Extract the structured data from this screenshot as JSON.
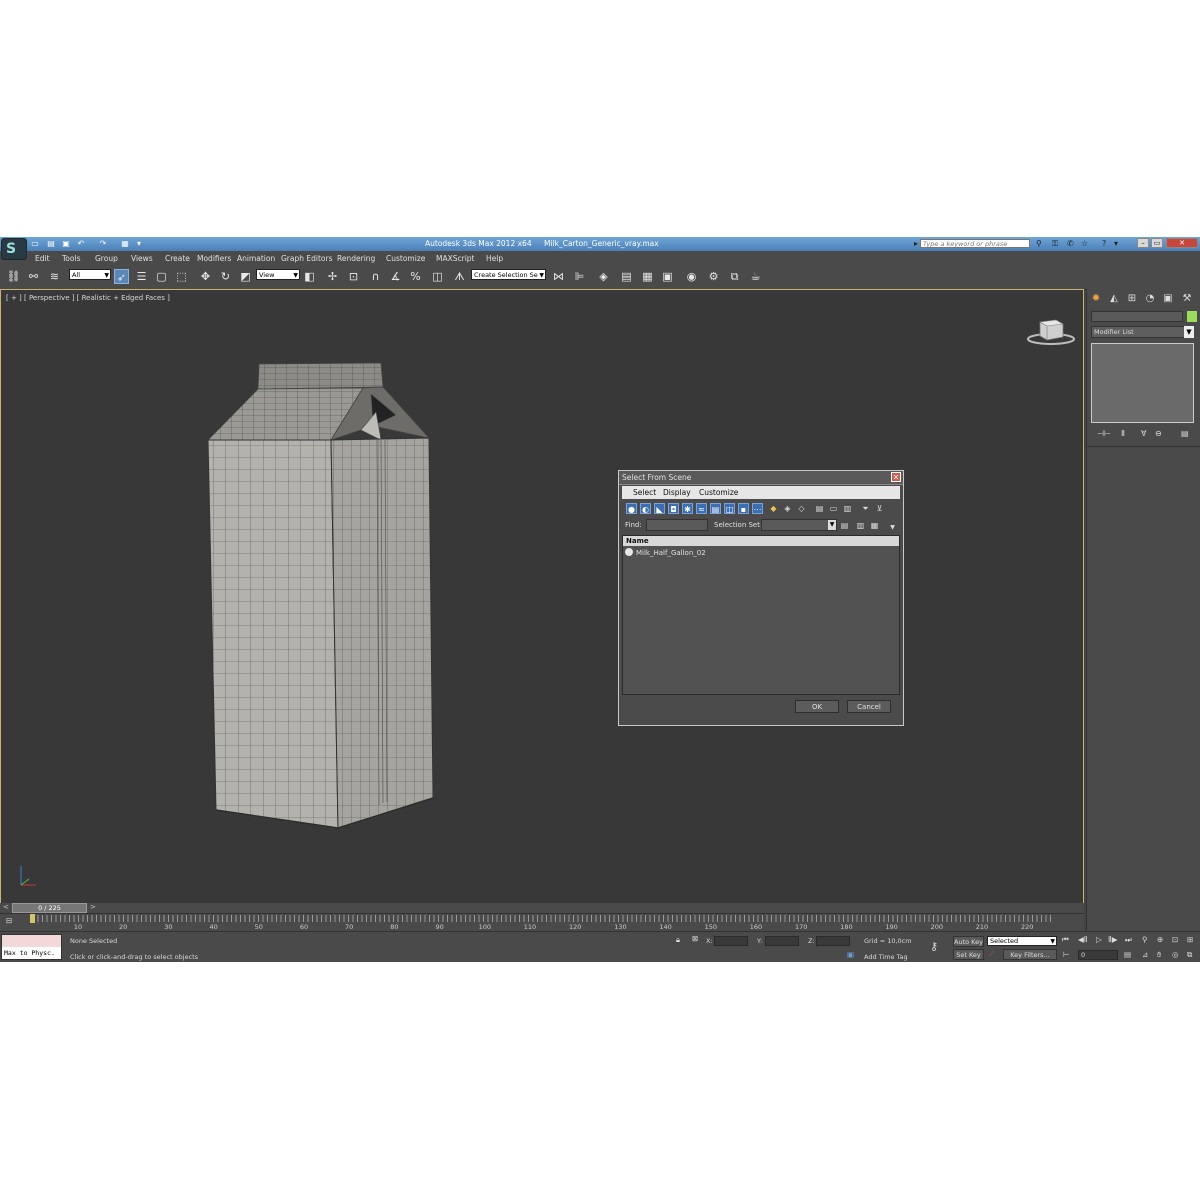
{
  "titlebar": {
    "app_title": "Autodesk 3ds Max  2012 x64",
    "file_name": "Milk_Carton_Generic_vray.max",
    "search_placeholder": "Type a keyword or phrase"
  },
  "menu": [
    "Edit",
    "Tools",
    "Group",
    "Views",
    "Create",
    "Modifiers",
    "Animation",
    "Graph Editors",
    "Rendering",
    "Customize",
    "MAXScript",
    "Help"
  ],
  "toolbar": {
    "selection_filter": "All",
    "reference_coord": "View",
    "named_selection": "Create Selection Se"
  },
  "viewport": {
    "label": "[ + ] [ Perspective ] [ Realistic + Edged Faces ]"
  },
  "command_panel": {
    "modifier_list": "Modifier List"
  },
  "timeline": {
    "frame_counter": "0 / 225",
    "prev_arrow": "<",
    "next_arrow": ">",
    "ticks": [
      "10",
      "20",
      "30",
      "40",
      "50",
      "60",
      "70",
      "80",
      "90",
      "100",
      "110",
      "120",
      "130",
      "140",
      "150",
      "160",
      "170",
      "180",
      "190",
      "200",
      "210",
      "220"
    ]
  },
  "status": {
    "maxscript_listener": "Max to Physc.",
    "selection_status": "None Selected",
    "prompt": "Click or click-and-drag to select objects",
    "x_label": "X:",
    "y_label": "Y:",
    "z_label": "Z:",
    "grid": "Grid = 10,0cm",
    "add_time_tag": "Add Time Tag",
    "auto_key": "Auto Key",
    "set_key": "Set Key",
    "key_mode": "Selected",
    "key_filters": "Key Filters...",
    "current_frame": "0"
  },
  "dialog": {
    "title": "Select From Scene",
    "menu": [
      "Select",
      "Display",
      "Customize"
    ],
    "find_label": "Find:",
    "selection_set_label": "Selection Set:",
    "column_header": "Name",
    "items": [
      "Milk_Half_Gallon_02"
    ],
    "ok": "OK",
    "cancel": "Cancel"
  },
  "colors": {
    "viewport_border": "#c9b36a",
    "active_tool": "#5a86b8",
    "object_color": "#9bdc5a",
    "title_gradient_top": "#6fa5d6"
  }
}
